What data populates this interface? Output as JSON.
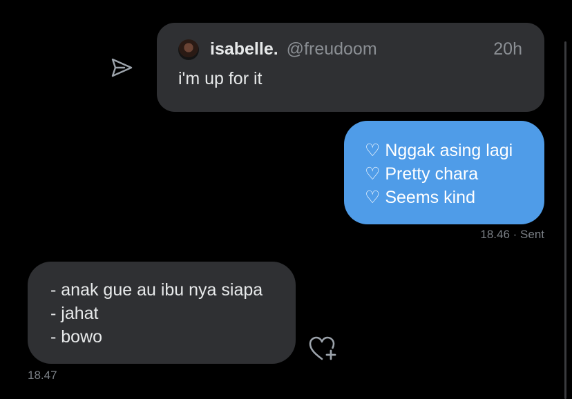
{
  "share": {
    "icon": "send-arrow-icon"
  },
  "quote": {
    "avatar_icon": "user-avatar",
    "name": "isabelle.",
    "handle": "@freudoom",
    "time": "20h",
    "text": "i'm up for it"
  },
  "sent_message": {
    "lines": [
      "♡ Nggak asing lagi",
      "♡ Pretty chara",
      "♡ Seems kind"
    ],
    "time": "18.46",
    "status": "· Sent"
  },
  "received_message": {
    "lines": [
      "- anak gue au ibu nya siapa",
      "- jahat",
      "- bowo"
    ],
    "time": "18.47"
  },
  "reaction": {
    "icon": "heart-add-icon"
  },
  "colors": {
    "background": "#000000",
    "bubble_gray": "#2f3033",
    "bubble_blue": "#4f9ce8",
    "text_primary": "#e7e9ea",
    "text_muted": "#7a7f85"
  }
}
